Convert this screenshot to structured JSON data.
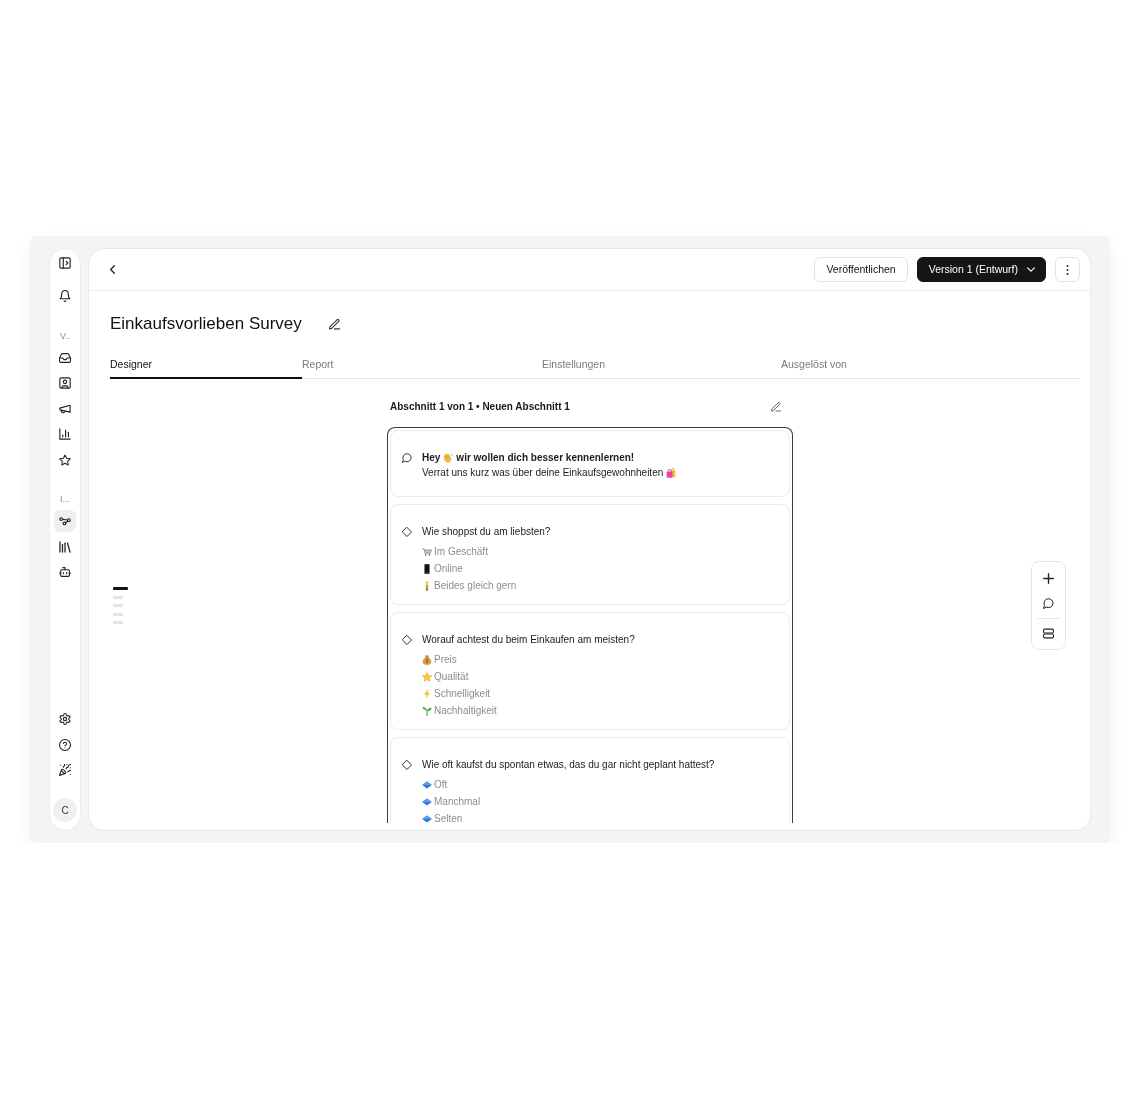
{
  "sidebar": {
    "top": [
      {
        "kind": "panel",
        "selected": false
      },
      {
        "kind": "bell",
        "selected": false
      }
    ],
    "groups": [
      {
        "label": "V..",
        "items": [
          {
            "kind": "inbox",
            "selected": false
          },
          {
            "kind": "contact",
            "selected": false
          },
          {
            "kind": "megaphone",
            "selected": false
          },
          {
            "kind": "chart",
            "selected": false
          },
          {
            "kind": "star",
            "selected": false
          }
        ]
      },
      {
        "label": "I...",
        "items": [
          {
            "kind": "workflow",
            "selected": true
          },
          {
            "kind": "library",
            "selected": false
          },
          {
            "kind": "bot",
            "selected": false
          }
        ]
      }
    ],
    "bottom": [
      {
        "kind": "settings",
        "selected": false
      },
      {
        "kind": "help",
        "selected": false
      },
      {
        "kind": "party",
        "selected": false
      }
    ],
    "avatar": "C"
  },
  "header": {
    "buttons": [
      {
        "kind": "publish",
        "label": "Veröffentlichen"
      },
      {
        "kind": "version",
        "label": "Version 1 (Entwurf)"
      }
    ]
  },
  "title": "Einkaufsvorlieben Survey",
  "tabs": [
    {
      "label": "Designer",
      "selected": true
    },
    {
      "label": "Report",
      "selected": false
    },
    {
      "label": "Einstellungen",
      "selected": false
    },
    {
      "label": "Ausgelöst von",
      "selected": false
    }
  ],
  "section": {
    "heading": "Abschnitt 1 von 1 • Neuen Abschnitt 1",
    "blocks": [
      {
        "kind": "statement",
        "heading": [
          {
            "kind": "text",
            "text": "Hey"
          },
          {
            "kind": "wave"
          },
          {
            "kind": "text",
            "text": "wir wollen dich besser kennenlernen!"
          }
        ],
        "body": [
          {
            "kind": "text",
            "text": "Verrat uns kurz was über deine Einkaufsgewohnheiten"
          },
          {
            "kind": "bags"
          }
        ]
      },
      {
        "kind": "question",
        "question": "Wie shoppst du am liebsten?",
        "options": [
          {
            "kind": "cart",
            "text": "Im Geschäft"
          },
          {
            "kind": "phone",
            "text": "Online"
          },
          {
            "kind": "person",
            "text": "Beides gleich gern"
          }
        ]
      },
      {
        "kind": "question",
        "question": "Worauf achtest du beim Einkaufen am meisten?",
        "options": [
          {
            "kind": "moneybag",
            "text": "Preis"
          },
          {
            "kind": "star",
            "text": "Qualität"
          },
          {
            "kind": "bolt",
            "text": "Schnelligkeit"
          },
          {
            "kind": "sprout",
            "text": "Nachhaltigkeit"
          }
        ]
      },
      {
        "kind": "question",
        "question": "Wie oft kaufst du spontan etwas, das du gar nicht geplant hattest?",
        "options": [
          {
            "kind": "diamond",
            "text": "Oft"
          },
          {
            "kind": "diamond",
            "text": "Manchmal"
          },
          {
            "kind": "diamond",
            "text": "Selten"
          }
        ]
      }
    ]
  },
  "section_markers": [
    {
      "selected": true
    },
    {
      "selected": false
    },
    {
      "selected": false
    },
    {
      "selected": false
    },
    {
      "selected": false
    }
  ],
  "toolbar": {
    "groups": [
      [
        {
          "kind": "add"
        },
        {
          "kind": "comment"
        }
      ],
      [
        {
          "kind": "sections"
        }
      ]
    ]
  }
}
